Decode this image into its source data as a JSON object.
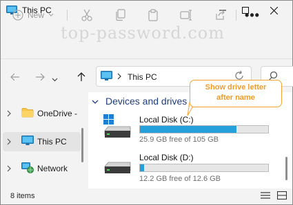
{
  "window": {
    "title": "This PC",
    "title_icon": "pc-icon"
  },
  "caption_buttons": [
    "minimize-icon",
    "maximize-icon",
    "close-icon"
  ],
  "watermark": "top-password.com",
  "command_bar": {
    "new_label": "New",
    "icons": [
      "cut-icon",
      "copy-icon",
      "paste-icon",
      "rename-icon",
      "share-icon",
      "delete-icon"
    ],
    "more_label": "•••"
  },
  "address_bar": {
    "path": "This PC",
    "icon": "pc-icon",
    "search_placeholder": ""
  },
  "sidebar": {
    "items": [
      {
        "label": "OneDrive -",
        "icon": "folder-icon",
        "selected": false
      },
      {
        "label": "This PC",
        "icon": "pc-icon",
        "selected": true
      },
      {
        "label": "Network",
        "icon": "network-icon",
        "selected": false
      }
    ]
  },
  "main": {
    "group_header": "Devices and drives",
    "drives": [
      {
        "name": "Local Disk (C:)",
        "free_text": "25.9 GB free of 105 GB",
        "used_fraction": 0.753,
        "icon": "system-drive-icon"
      },
      {
        "name": "Local Disk (D:)",
        "free_text": "12.2 GB free of 12.6 GB",
        "used_fraction": 0.032,
        "icon": "drive-icon"
      }
    ]
  },
  "callout": {
    "line1": "Show drive letter",
    "line2": "after name",
    "color": "#f09a24"
  },
  "status_bar": {
    "item_count": "8 items"
  },
  "colors": {
    "accent": "#26a0da",
    "background": "#f3f3f3",
    "content": "#ffffff"
  }
}
